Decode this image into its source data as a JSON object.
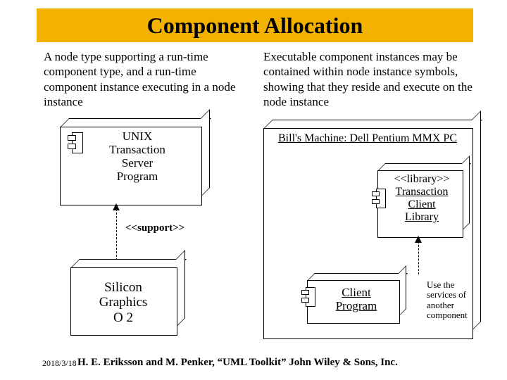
{
  "title": "Component Allocation",
  "paragraphs": {
    "left": "A node type supporting a run-time component type, and a run-time component instance executing in a node instance",
    "right": "Executable component instances may be contained within node instance symbols, showing that they reside and execute on the node instance"
  },
  "left_component": {
    "line1": "UNIX",
    "line2": "Transaction",
    "line3": "Server",
    "line4": "Program"
  },
  "support_label": "<<support>>",
  "left_node": {
    "line1": "Silicon",
    "line2": "Graphics",
    "line3": "O 2"
  },
  "right_node_title": "Bill's Machine: Dell Pentium MMX PC",
  "right_library": {
    "line1": "<<library>>",
    "line2": "Transaction",
    "line3": "Client",
    "line4": "Library"
  },
  "right_client": {
    "line1": "Client",
    "line2": "Program"
  },
  "annotation": {
    "line1": "Use the",
    "line2": "services of",
    "line3": "another",
    "line4": "component"
  },
  "footer": {
    "date": "2018/3/18",
    "citation": "H. E. Eriksson and M. Penker, “UML Toolkit” John Wiley & Sons, Inc."
  }
}
